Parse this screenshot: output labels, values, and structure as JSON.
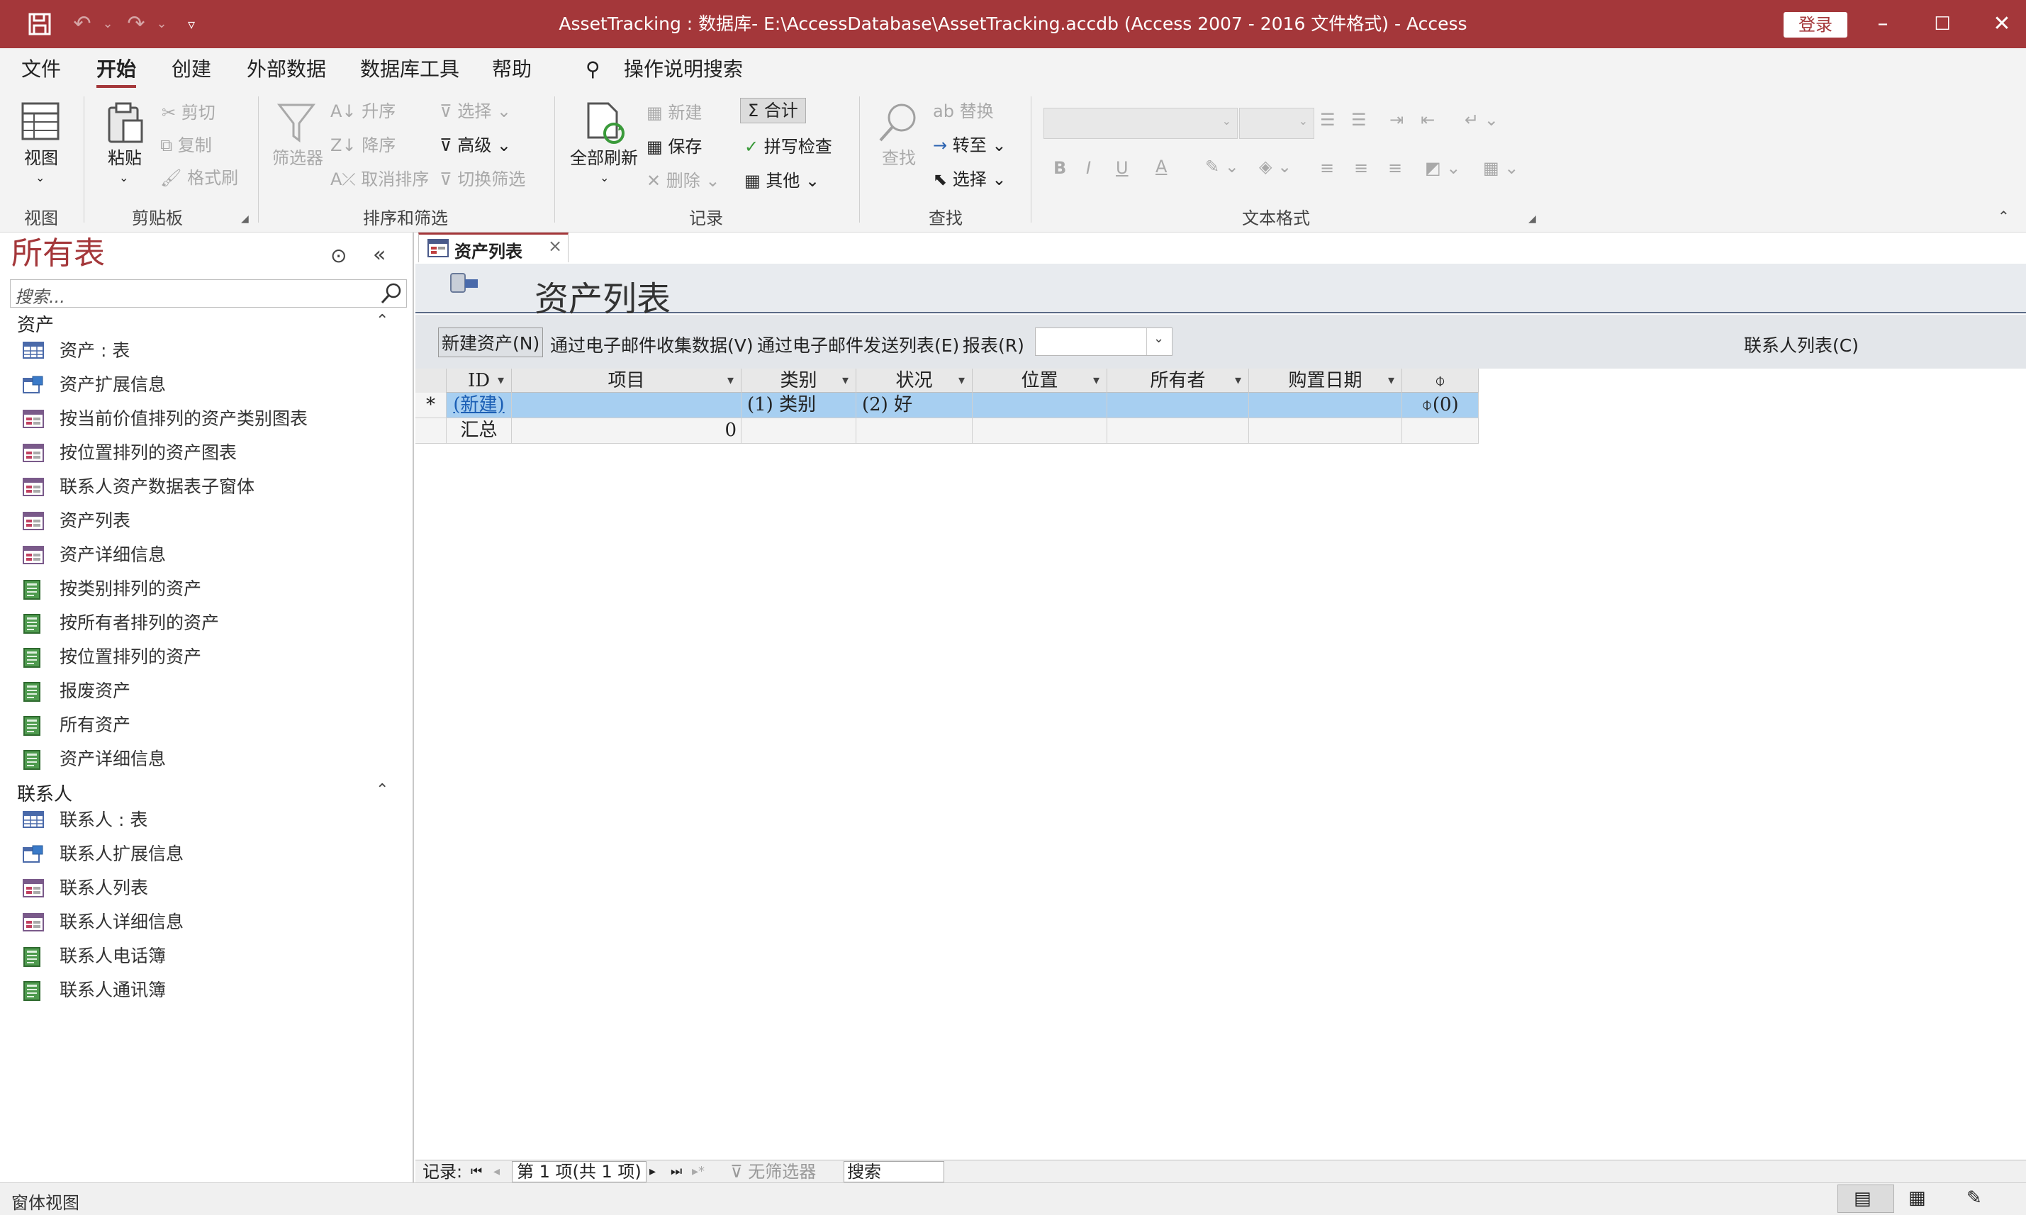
{
  "window": {
    "title": "AssetTracking : 数据库- E:\\AccessDatabase\\AssetTracking.accdb (Access 2007 - 2016 文件格式)  -  Access",
    "signin_label": "登录",
    "accent": "#a4373a"
  },
  "menu": {
    "tabs": [
      {
        "label": "文件",
        "active": false
      },
      {
        "label": "开始",
        "active": true
      },
      {
        "label": "创建",
        "active": false
      },
      {
        "label": "外部数据",
        "active": false
      },
      {
        "label": "数据库工具",
        "active": false
      },
      {
        "label": "帮助",
        "active": false
      }
    ],
    "tell_me": "操作说明搜索"
  },
  "ribbon": {
    "view": {
      "button": "视图",
      "group": "视图"
    },
    "clipboard": {
      "paste": "粘贴",
      "cut": "剪切",
      "copy": "复制",
      "format_painter": "格式刷",
      "group": "剪贴板"
    },
    "sort_filter": {
      "filter": "筛选器",
      "ascending": "升序",
      "descending": "降序",
      "remove_sort": "取消排序",
      "selection": "选择",
      "advanced": "高级",
      "toggle_filter": "切换筛选",
      "group": "排序和筛选"
    },
    "records": {
      "refresh_all": "全部刷新",
      "new": "新建",
      "save": "保存",
      "delete": "删除",
      "totals": "合计",
      "spelling": "拼写检查",
      "more": "其他",
      "group": "记录"
    },
    "find": {
      "find": "查找",
      "replace": "替换",
      "goto": "转至",
      "select": "选择",
      "group": "查找"
    },
    "text_format": {
      "bold": "B",
      "italic": "I",
      "underline": "U",
      "font_color": "A",
      "group": "文本格式"
    }
  },
  "nav": {
    "title": "所有表",
    "search_placeholder": "搜索...",
    "groups": [
      {
        "name": "资产",
        "items": [
          {
            "label": "资产 : 表",
            "icon": "table-icon"
          },
          {
            "label": "资产扩展信息",
            "icon": "query-icon"
          },
          {
            "label": "按当前价值排列的资产类别图表",
            "icon": "form-icon"
          },
          {
            "label": "按位置排列的资产图表",
            "icon": "form-icon"
          },
          {
            "label": "联系人资产数据表子窗体",
            "icon": "form-icon"
          },
          {
            "label": "资产列表",
            "icon": "form-icon"
          },
          {
            "label": "资产详细信息",
            "icon": "form-icon"
          },
          {
            "label": "按类别排列的资产",
            "icon": "report-icon"
          },
          {
            "label": "按所有者排列的资产",
            "icon": "report-icon"
          },
          {
            "label": "按位置排列的资产",
            "icon": "report-icon"
          },
          {
            "label": "报废资产",
            "icon": "report-icon"
          },
          {
            "label": "所有资产",
            "icon": "report-icon"
          },
          {
            "label": "资产详细信息",
            "icon": "report-icon"
          }
        ]
      },
      {
        "name": "联系人",
        "items": [
          {
            "label": "联系人 : 表",
            "icon": "table-icon"
          },
          {
            "label": "联系人扩展信息",
            "icon": "query-icon"
          },
          {
            "label": "联系人列表",
            "icon": "form-icon"
          },
          {
            "label": "联系人详细信息",
            "icon": "form-icon"
          },
          {
            "label": "联系人电话簿",
            "icon": "report-icon"
          },
          {
            "label": "联系人通讯簿",
            "icon": "report-icon"
          }
        ]
      }
    ]
  },
  "document": {
    "tab_label": "资产列表",
    "form_title": "资产列表",
    "commands": {
      "new_asset": "新建资产(N)",
      "collect_email": "通过电子邮件收集数据(V)",
      "send_email": "通过电子邮件发送列表(E)",
      "reports": "报表(R)",
      "contacts_list": "联系人列表(C)"
    },
    "columns": [
      "ID",
      "项目",
      "类别",
      "状况",
      "位置",
      "所有者",
      "购置日期"
    ],
    "new_row": {
      "marker": "*",
      "id": "(新建)",
      "category": "(1) 类别",
      "condition": "(2) 好",
      "attachments": "(0)"
    },
    "total_row": {
      "label": "汇总",
      "value": "0"
    }
  },
  "record_nav": {
    "label": "记录:",
    "position": "第 1 项(共 1 项)",
    "filter": "无筛选器",
    "search": "搜索"
  },
  "status": {
    "view_label": "窗体视图"
  }
}
